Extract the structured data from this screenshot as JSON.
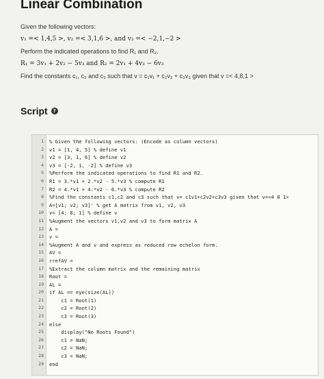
{
  "title": "Linear Combination",
  "problem": {
    "intro": "Given the following vectors:",
    "vectors": "v₁ =< 1,4,5 >,  v₂ =< 3,1,6 >,  and  v₃ =< −2,1,−2 >",
    "instruction": "Perform the indicated operations to find R₁ and R₂.",
    "equations": "R₁ = 3v₁ + 2v₂ − 5v₃  and  R₂ = 2v₁ + 4v₂ − 6v₃",
    "find": "Find the constants c₁, c₂ and c₃ such that  v = c₁v₁ + c₂v₂ + c₃v₃  given that  v =< 4,8,1 >"
  },
  "script": {
    "heading": "Script",
    "help_icon": "question-circle-icon"
  },
  "code_lines": [
    "% Given the following vectors: (Encode as column vectors)",
    "v1 = [1, 4, 5] % define v1",
    "v2 = [3, 1, 6] % define v2",
    "v3 = [-2, 1, -2] % define v3",
    "%Perform the indicated operations to find R1 and R2.",
    "R1 = 3.*v1 + 2.*v2 - 5.*v3 % compute R1",
    "R2 = 4.*v1 + 4.*v2 - 6.*v3 % compute R2",
    "%Find the constants c1,c2 and c3 such that v= c1v1+c2v2+c3v3 given that v=<4 8 1>",
    "A=[v1; v2; v3]' % get A matrix from v1, v2, v3",
    "v= [4; 8; 1] % define v",
    "%Augment the vectors v1,v2 and v3 to form matrix A",
    "A =",
    "v =",
    "%Augment A and v and express as reduced row echelon form.",
    "AV =",
    "rrefAV =",
    "%Extract the column matrix and the remaining matrix",
    "Root =",
    "AL =",
    "if AL == eye(size(AL))",
    "    c1 = Root(1)",
    "    c2 = Root(2)",
    "    c3 = Root(3)",
    "else",
    "    display(\"No Roots Found\")",
    "    c1 = NaN;",
    "    c2 = NaN;",
    "    c3 = NaN;",
    "end"
  ],
  "line_numbers": [
    "1",
    "2",
    "3",
    "4",
    "5",
    "6",
    "7",
    "8",
    "9",
    "10",
    "11",
    "12",
    "13",
    "14",
    "15",
    "16",
    "17",
    "18",
    "19",
    "20",
    "21",
    "22",
    "23",
    "24",
    "25",
    "26",
    "27",
    "28",
    "29"
  ]
}
